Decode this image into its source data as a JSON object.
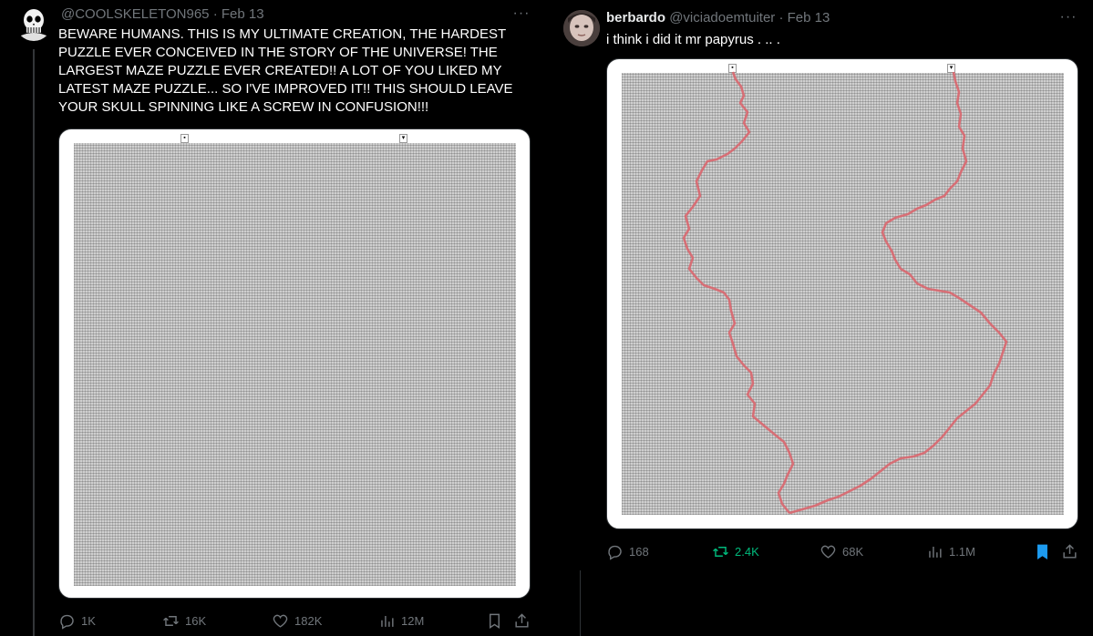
{
  "left_tweet": {
    "display_name": "",
    "handle": "@COOLSKELETON965",
    "separator": "·",
    "date": "Feb 13",
    "more": "···",
    "text": "BEWARE HUMANS. THIS IS MY ULTIMATE CREATION, THE HARDEST PUZZLE EVER CONCEIVED IN THE STORY OF THE UNIVERSE! THE LARGEST MAZE PUZZLE EVER CREATED!! A LOT OF YOU LIKED MY LATEST MAZE PUZZLE... SO I'VE IMPROVED IT!! THIS SHOULD LEAVE YOUR SKULL SPINNING LIKE A SCREW IN CONFUSION!!!",
    "media": {
      "description": "maze-image-unsolved"
    },
    "actions": {
      "replies": "1K",
      "reposts": "16K",
      "likes": "182K",
      "views": "12M"
    }
  },
  "right_tweet": {
    "display_name": "berbardo",
    "handle": "@viciadoemtuiter",
    "separator": "·",
    "date": "Feb 13",
    "more": "···",
    "text": "i think i did it mr papyrus . .. .",
    "media": {
      "description": "maze-image-solved",
      "path_color": "#d9666e"
    },
    "actions": {
      "replies": "168",
      "reposts": "2.4K",
      "likes": "68K",
      "views": "1.1M"
    }
  },
  "colors": {
    "accent": "#1d9bf0",
    "repost_active": "#00ba7c",
    "muted": "#71767b"
  }
}
